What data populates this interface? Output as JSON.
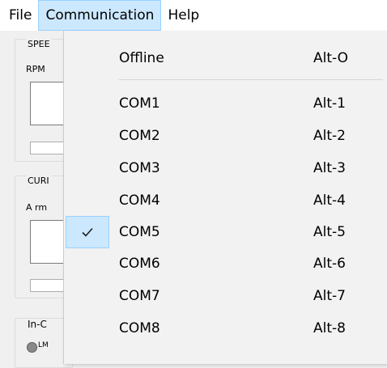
{
  "menubar": {
    "items": [
      {
        "label": "File"
      },
      {
        "label": "Communication"
      },
      {
        "label": "Help"
      }
    ]
  },
  "background": {
    "speed_group": "SPEE",
    "rpm_label": "RPM",
    "current_group": "CURI",
    "amps_label": "A rm",
    "inc_group": "In-C",
    "radio_label": "LM"
  },
  "menu": {
    "offline": {
      "label": "Offline",
      "shortcut": "Alt-O"
    },
    "ports": [
      {
        "label": "COM1",
        "shortcut": "Alt-1",
        "checked": false
      },
      {
        "label": "COM2",
        "shortcut": "Alt-2",
        "checked": false
      },
      {
        "label": "COM3",
        "shortcut": "Alt-3",
        "checked": false
      },
      {
        "label": "COM4",
        "shortcut": "Alt-4",
        "checked": false
      },
      {
        "label": "COM5",
        "shortcut": "Alt-5",
        "checked": true
      },
      {
        "label": "COM6",
        "shortcut": "Alt-6",
        "checked": false
      },
      {
        "label": "COM7",
        "shortcut": "Alt-7",
        "checked": false
      },
      {
        "label": "COM8",
        "shortcut": "Alt-8",
        "checked": false
      }
    ]
  },
  "colors": {
    "highlight_bg": "#cce8ff",
    "highlight_border": "#99d1ff",
    "check_color": "#1e1e1e"
  },
  "icons": {
    "selected_port": "check-icon"
  }
}
